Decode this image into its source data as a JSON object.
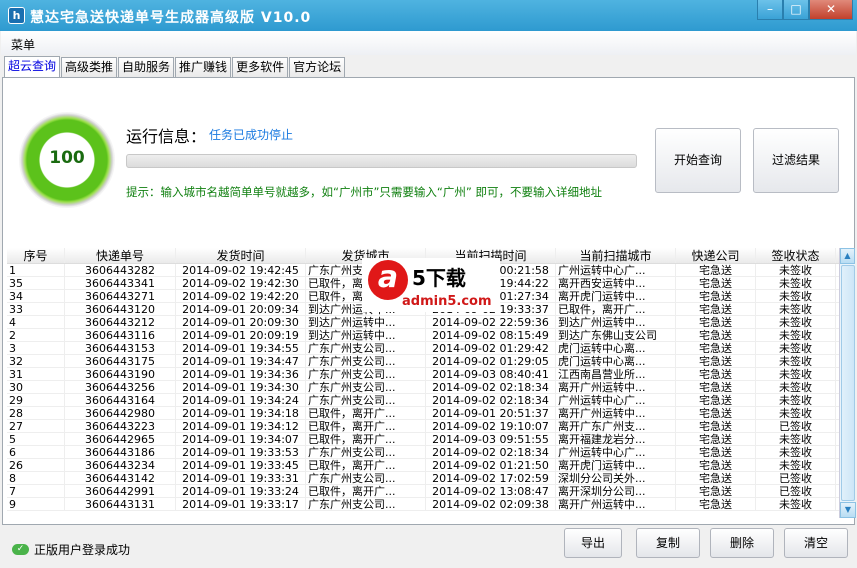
{
  "window": {
    "title": "慧达宅急送快递单号生成器高级版 V10.0",
    "minimize": "–",
    "maximize": "□",
    "close": "✕"
  },
  "menu": {
    "label": "菜单"
  },
  "tabs": [
    {
      "label": "超云查询",
      "active": true
    },
    {
      "label": "高级类推"
    },
    {
      "label": "自助服务"
    },
    {
      "label": "推广赚钱"
    },
    {
      "label": "更多软件"
    },
    {
      "label": "官方论坛"
    }
  ],
  "progress": {
    "value": 100,
    "label": "100",
    "run_label": "运行信息：",
    "run_status": "任务已成功停止"
  },
  "hint": "提示：输入城市名越简单单号就越多，如“广州市”只需要输入“广州” 即可，不要输入详细地址",
  "buttons": {
    "start": "开始查询",
    "filter": "过滤结果",
    "export": "导出",
    "copy": "复制",
    "delete": "删除",
    "clear": "清空"
  },
  "table": {
    "columns": [
      "序号",
      "快递单号",
      "发货时间",
      "发货城市",
      "当前扫描时间",
      "当前扫描城市",
      "快递公司",
      "签收状态"
    ],
    "rows": [
      [
        "1",
        "3606443282",
        "2014-09-02 19:42:45",
        "广东广州支公司...",
        "2014-09-03 00:21:58",
        "广州运转中心广...",
        "宅急送",
        "未签收"
      ],
      [
        "35",
        "3606443341",
        "2014-09-02 19:42:30",
        "已取件，离开广...",
        "2014-09-02 19:44:22",
        "离开西安运转中...",
        "宅急送",
        "未签收"
      ],
      [
        "34",
        "3606443271",
        "2014-09-02 19:42:20",
        "已取件，离开广...",
        "2014-09-03 01:27:34",
        "离开虎门运转中...",
        "宅急送",
        "未签收"
      ],
      [
        "33",
        "3606443120",
        "2014-09-01 20:09:34",
        "到达广州运转中...",
        "2014-09-02 19:33:37",
        "已取件，离开广...",
        "宅急送",
        "未签收"
      ],
      [
        "4",
        "3606443212",
        "2014-09-01 20:09:30",
        "到达广州运转中...",
        "2014-09-02 22:59:36",
        "到达广州运转中...",
        "宅急送",
        "未签收"
      ],
      [
        "2",
        "3606443116",
        "2014-09-01 20:09:19",
        "到达广州运转中...",
        "2014-09-02 08:15:49",
        "到达广东佛山支公司",
        "宅急送",
        "未签收"
      ],
      [
        "3",
        "3606443153",
        "2014-09-01 19:34:55",
        "广东广州支公司...",
        "2014-09-02 01:29:42",
        "虎门运转中心离...",
        "宅急送",
        "未签收"
      ],
      [
        "32",
        "3606443175",
        "2014-09-01 19:34:47",
        "广东广州支公司...",
        "2014-09-02 01:29:05",
        "虎门运转中心离...",
        "宅急送",
        "未签收"
      ],
      [
        "31",
        "3606443190",
        "2014-09-01 19:34:36",
        "广东广州支公司...",
        "2014-09-03 08:40:41",
        "江西南昌营业所...",
        "宅急送",
        "未签收"
      ],
      [
        "30",
        "3606443256",
        "2014-09-01 19:34:30",
        "广东广州支公司...",
        "2014-09-02 02:18:34",
        "离开广州运转中...",
        "宅急送",
        "未签收"
      ],
      [
        "29",
        "3606443164",
        "2014-09-01 19:34:24",
        "广东广州支公司...",
        "2014-09-02 02:18:34",
        "广州运转中心广...",
        "宅急送",
        "未签收"
      ],
      [
        "28",
        "3606442980",
        "2014-09-01 19:34:18",
        "已取件，离开广...",
        "2014-09-01 20:51:37",
        "离开广州运转中...",
        "宅急送",
        "未签收"
      ],
      [
        "27",
        "3606443223",
        "2014-09-01 19:34:12",
        "已取件，离开广...",
        "2014-09-02 19:10:07",
        "离开广东广州支...",
        "宅急送",
        "已签收"
      ],
      [
        "5",
        "3606442965",
        "2014-09-01 19:34:07",
        "已取件，离开广...",
        "2014-09-03 09:51:55",
        "离开福建龙岩分...",
        "宅急送",
        "未签收"
      ],
      [
        "6",
        "3606443186",
        "2014-09-01 19:33:53",
        "广东广州支公司...",
        "2014-09-02 02:18:34",
        "广州运转中心广...",
        "宅急送",
        "未签收"
      ],
      [
        "26",
        "3606443234",
        "2014-09-01 19:33:45",
        "已取件，离开广...",
        "2014-09-02 01:21:50",
        "离开虎门运转中...",
        "宅急送",
        "未签收"
      ],
      [
        "8",
        "3606443142",
        "2014-09-01 19:33:31",
        "广东广州支公司...",
        "2014-09-02 17:02:59",
        "深圳分公司关外...",
        "宅急送",
        "已签收"
      ],
      [
        "7",
        "3606442991",
        "2014-09-01 19:33:24",
        "已取件，离开广...",
        "2014-09-02 13:08:47",
        "离开深圳分公司...",
        "宅急送",
        "已签收"
      ],
      [
        "9",
        "3606443131",
        "2014-09-01 19:33:17",
        "广东广州支公司...",
        "2014-09-02 02:09:38",
        "离开广州运转中...",
        "宅急送",
        "未签收"
      ]
    ]
  },
  "watermark": {
    "logo": "a5",
    "text": "下载",
    "url": "admin5.com"
  },
  "status": {
    "text": "正版用户登录成功",
    "icon": "cloud-check-icon"
  }
}
